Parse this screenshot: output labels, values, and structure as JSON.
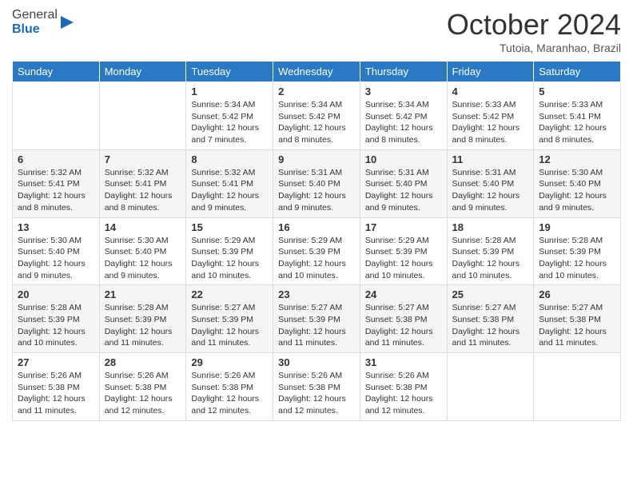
{
  "header": {
    "logo_general": "General",
    "logo_blue": "Blue",
    "month_title": "October 2024",
    "location": "Tutoia, Maranhao, Brazil"
  },
  "days_of_week": [
    "Sunday",
    "Monday",
    "Tuesday",
    "Wednesday",
    "Thursday",
    "Friday",
    "Saturday"
  ],
  "weeks": [
    [
      {
        "day": "",
        "info": ""
      },
      {
        "day": "",
        "info": ""
      },
      {
        "day": "1",
        "info": "Sunrise: 5:34 AM\nSunset: 5:42 PM\nDaylight: 12 hours and 7 minutes."
      },
      {
        "day": "2",
        "info": "Sunrise: 5:34 AM\nSunset: 5:42 PM\nDaylight: 12 hours and 8 minutes."
      },
      {
        "day": "3",
        "info": "Sunrise: 5:34 AM\nSunset: 5:42 PM\nDaylight: 12 hours and 8 minutes."
      },
      {
        "day": "4",
        "info": "Sunrise: 5:33 AM\nSunset: 5:42 PM\nDaylight: 12 hours and 8 minutes."
      },
      {
        "day": "5",
        "info": "Sunrise: 5:33 AM\nSunset: 5:41 PM\nDaylight: 12 hours and 8 minutes."
      }
    ],
    [
      {
        "day": "6",
        "info": "Sunrise: 5:32 AM\nSunset: 5:41 PM\nDaylight: 12 hours and 8 minutes."
      },
      {
        "day": "7",
        "info": "Sunrise: 5:32 AM\nSunset: 5:41 PM\nDaylight: 12 hours and 8 minutes."
      },
      {
        "day": "8",
        "info": "Sunrise: 5:32 AM\nSunset: 5:41 PM\nDaylight: 12 hours and 9 minutes."
      },
      {
        "day": "9",
        "info": "Sunrise: 5:31 AM\nSunset: 5:40 PM\nDaylight: 12 hours and 9 minutes."
      },
      {
        "day": "10",
        "info": "Sunrise: 5:31 AM\nSunset: 5:40 PM\nDaylight: 12 hours and 9 minutes."
      },
      {
        "day": "11",
        "info": "Sunrise: 5:31 AM\nSunset: 5:40 PM\nDaylight: 12 hours and 9 minutes."
      },
      {
        "day": "12",
        "info": "Sunrise: 5:30 AM\nSunset: 5:40 PM\nDaylight: 12 hours and 9 minutes."
      }
    ],
    [
      {
        "day": "13",
        "info": "Sunrise: 5:30 AM\nSunset: 5:40 PM\nDaylight: 12 hours and 9 minutes."
      },
      {
        "day": "14",
        "info": "Sunrise: 5:30 AM\nSunset: 5:40 PM\nDaylight: 12 hours and 9 minutes."
      },
      {
        "day": "15",
        "info": "Sunrise: 5:29 AM\nSunset: 5:39 PM\nDaylight: 12 hours and 10 minutes."
      },
      {
        "day": "16",
        "info": "Sunrise: 5:29 AM\nSunset: 5:39 PM\nDaylight: 12 hours and 10 minutes."
      },
      {
        "day": "17",
        "info": "Sunrise: 5:29 AM\nSunset: 5:39 PM\nDaylight: 12 hours and 10 minutes."
      },
      {
        "day": "18",
        "info": "Sunrise: 5:28 AM\nSunset: 5:39 PM\nDaylight: 12 hours and 10 minutes."
      },
      {
        "day": "19",
        "info": "Sunrise: 5:28 AM\nSunset: 5:39 PM\nDaylight: 12 hours and 10 minutes."
      }
    ],
    [
      {
        "day": "20",
        "info": "Sunrise: 5:28 AM\nSunset: 5:39 PM\nDaylight: 12 hours and 10 minutes."
      },
      {
        "day": "21",
        "info": "Sunrise: 5:28 AM\nSunset: 5:39 PM\nDaylight: 12 hours and 11 minutes."
      },
      {
        "day": "22",
        "info": "Sunrise: 5:27 AM\nSunset: 5:39 PM\nDaylight: 12 hours and 11 minutes."
      },
      {
        "day": "23",
        "info": "Sunrise: 5:27 AM\nSunset: 5:39 PM\nDaylight: 12 hours and 11 minutes."
      },
      {
        "day": "24",
        "info": "Sunrise: 5:27 AM\nSunset: 5:38 PM\nDaylight: 12 hours and 11 minutes."
      },
      {
        "day": "25",
        "info": "Sunrise: 5:27 AM\nSunset: 5:38 PM\nDaylight: 12 hours and 11 minutes."
      },
      {
        "day": "26",
        "info": "Sunrise: 5:27 AM\nSunset: 5:38 PM\nDaylight: 12 hours and 11 minutes."
      }
    ],
    [
      {
        "day": "27",
        "info": "Sunrise: 5:26 AM\nSunset: 5:38 PM\nDaylight: 12 hours and 11 minutes."
      },
      {
        "day": "28",
        "info": "Sunrise: 5:26 AM\nSunset: 5:38 PM\nDaylight: 12 hours and 12 minutes."
      },
      {
        "day": "29",
        "info": "Sunrise: 5:26 AM\nSunset: 5:38 PM\nDaylight: 12 hours and 12 minutes."
      },
      {
        "day": "30",
        "info": "Sunrise: 5:26 AM\nSunset: 5:38 PM\nDaylight: 12 hours and 12 minutes."
      },
      {
        "day": "31",
        "info": "Sunrise: 5:26 AM\nSunset: 5:38 PM\nDaylight: 12 hours and 12 minutes."
      },
      {
        "day": "",
        "info": ""
      },
      {
        "day": "",
        "info": ""
      }
    ]
  ]
}
